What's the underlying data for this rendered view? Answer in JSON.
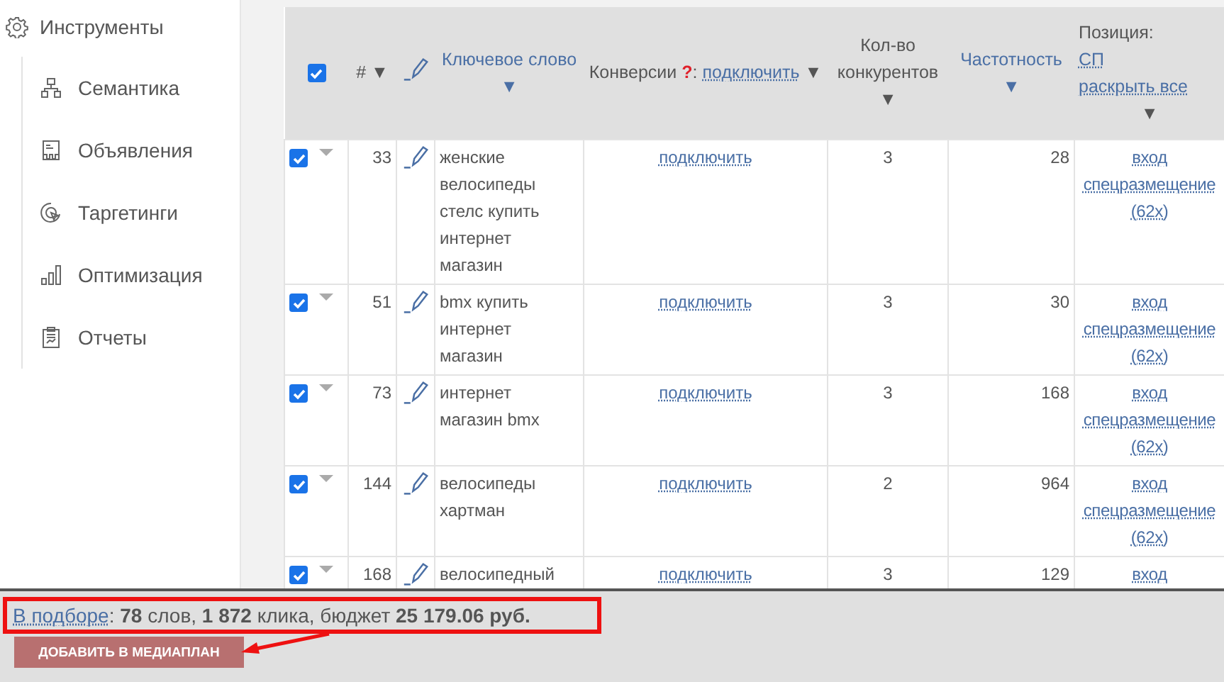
{
  "sidebar": {
    "title": "Инструменты",
    "items": [
      {
        "kind": "semantics",
        "label": "Семантика"
      },
      {
        "kind": "ads",
        "label": "Объявления"
      },
      {
        "kind": "targeting",
        "label": "Таргетинги"
      },
      {
        "kind": "optimization",
        "label": "Оптимизация"
      },
      {
        "kind": "reports",
        "label": "Отчеты"
      }
    ]
  },
  "table": {
    "header": {
      "checked": true,
      "number": "#",
      "number_sort": "▼",
      "keyword": "Ключевое слово ▼",
      "conversions": {
        "label": "Конверсии",
        "help": "?",
        "separator": ":",
        "link": "подключить",
        "sort": "▼"
      },
      "competitors": "Кол-во конкурентов ▼",
      "frequency": "Частотность ▼",
      "position": {
        "label": "Позиция:",
        "link_1": "СП",
        "link_2": "раскрыть все",
        "sort": "▼"
      }
    },
    "rows": [
      {
        "checked": true,
        "number": "33",
        "keyword": "женские велосипеды стелс купить интернет магазин",
        "conversions": "подключить",
        "competitors": "3",
        "frequency": "28",
        "position": "вход спецразмещение (62x)"
      },
      {
        "checked": true,
        "number": "51",
        "keyword": "bmx купить интернет магазин",
        "conversions": "подключить",
        "competitors": "3",
        "frequency": "30",
        "position": "вход спецразмещение (62x)"
      },
      {
        "checked": true,
        "number": "73",
        "keyword": "интернет магазин bmx",
        "conversions": "подключить",
        "competitors": "3",
        "frequency": "168",
        "position": "вход спецразмещение (62x)"
      },
      {
        "checked": true,
        "number": "144",
        "keyword": "велосипеды хартман",
        "conversions": "подключить",
        "competitors": "2",
        "frequency": "964",
        "position": "вход спецразмещение (62x)"
      },
      {
        "checked": true,
        "number": "168",
        "keyword": "велосипедный",
        "conversions": "подключить",
        "competitors": "3",
        "frequency": "129",
        "position": "вход"
      }
    ]
  },
  "summary": {
    "link": "В подборе",
    "text": ": **78** слов, **1 872** клика, бюджет **25 179.06 руб.**"
  },
  "add_button": "ДОБАВИТЬ В МЕДИАПЛАН"
}
